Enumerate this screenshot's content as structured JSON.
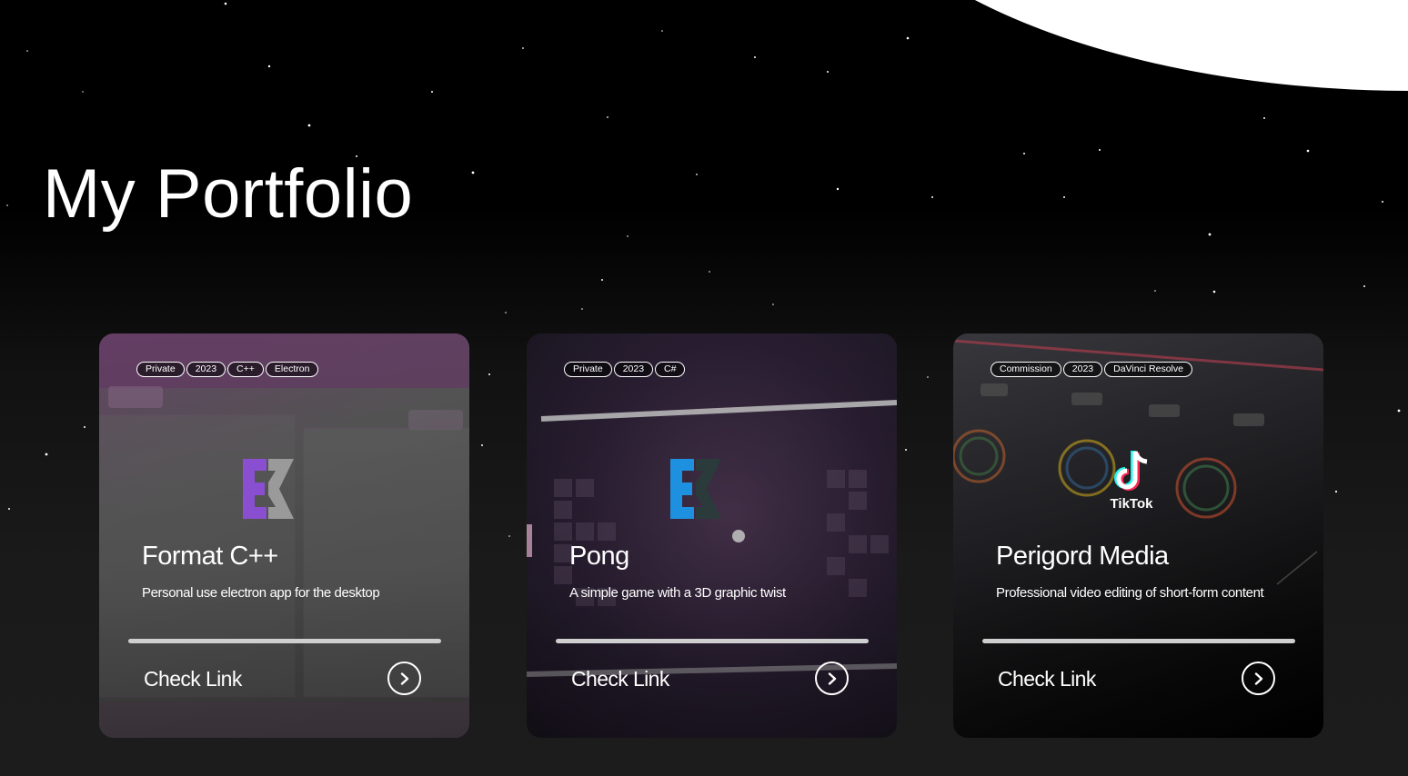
{
  "page": {
    "title": "My Portfolio"
  },
  "projects": [
    {
      "name": "Format C++",
      "description": "Personal use electron app for the desktop",
      "tags": [
        "Private",
        "2023",
        "C++",
        "Electron"
      ],
      "link_label": "Check Link",
      "logo_icon": "ek-logo-icon",
      "logo_color": "#8a4fd0"
    },
    {
      "name": "Pong",
      "description": "A simple game with a 3D graphic twist",
      "tags": [
        "Private",
        "2023",
        "C#"
      ],
      "link_label": "Check Link",
      "logo_icon": "ek-logo-icon",
      "logo_color": "#1e90e0"
    },
    {
      "name": "Perigord Media",
      "description": "Professional video editing of short-form content",
      "tags": [
        "Commission",
        "2023",
        "DaVinci Resolve"
      ],
      "link_label": "Check Link",
      "logo_icon": "tiktok-logo-icon",
      "logo_text": "TikTok"
    }
  ]
}
